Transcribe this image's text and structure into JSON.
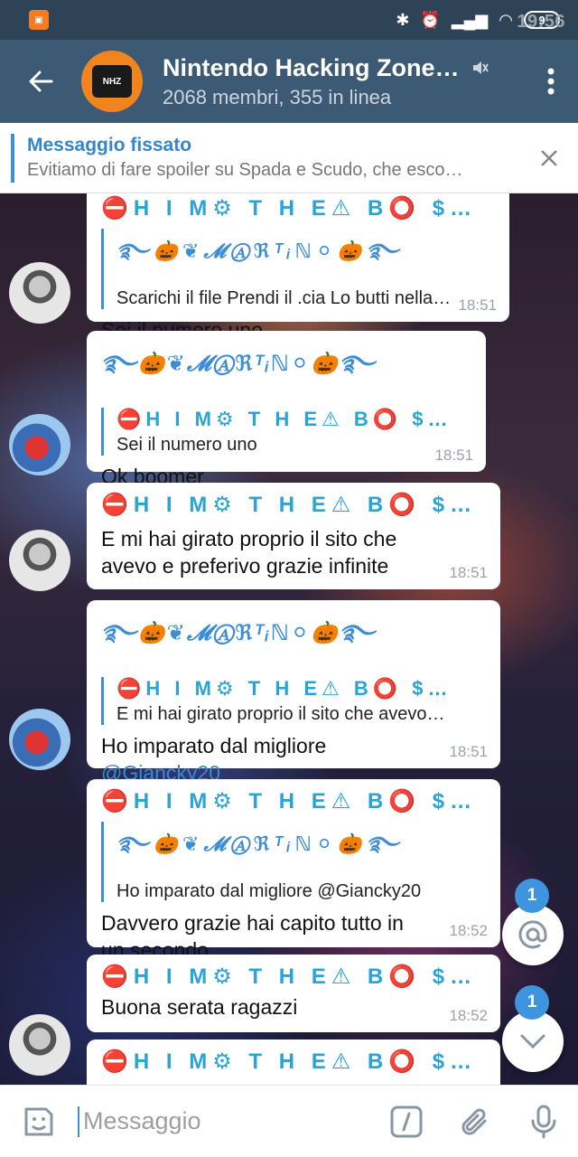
{
  "status": {
    "time": "19:56",
    "battery": "9"
  },
  "header": {
    "title": "Nintendo Hacking Zone…",
    "subtitle": "2068 membri, 355 in linea",
    "avatar_text": "NHZ"
  },
  "pinned": {
    "label": "Messaggio fissato",
    "text": "Evitiamo di fare spoiler su Spada e Scudo, che esco…"
  },
  "names": {
    "bothe": "⛔H I M⚙ T H E⚠ B⭕ $…",
    "martino": "࿐🎃❦𝓜Ⓐℜᵀᵢℕ⚪🎃࿐"
  },
  "messages": [
    {
      "reply_text": "Scarichi il file Prendi il .cia Lo butti nella…",
      "text": "Sei il numero uno",
      "time": "18:51"
    },
    {
      "reply_text": "Sei il numero uno",
      "text": "Ok boomer",
      "time": "18:51"
    },
    {
      "text": "E mi hai girato proprio il sito che avevo e preferivo grazie infinite",
      "time": "18:51"
    },
    {
      "reply_text": "E mi hai girato proprio il sito che avevo…",
      "text": "Ho imparato dal migliore",
      "mention": "@Giancky20",
      "time": "18:51"
    },
    {
      "reply_text": "Ho imparato dal migliore @Giancky20",
      "text": "Davvero grazie hai capito tutto in un secondo",
      "time": "18:52"
    },
    {
      "text": "Buona serata ragazzi",
      "time": "18:52"
    }
  ],
  "fabs": {
    "mentions_count": "1",
    "scroll_count": "1"
  },
  "input": {
    "placeholder": "Messaggio"
  },
  "colors": {
    "header": "#3c5a73",
    "accent": "#3f8fd6",
    "status_bar": "#2f4357"
  }
}
